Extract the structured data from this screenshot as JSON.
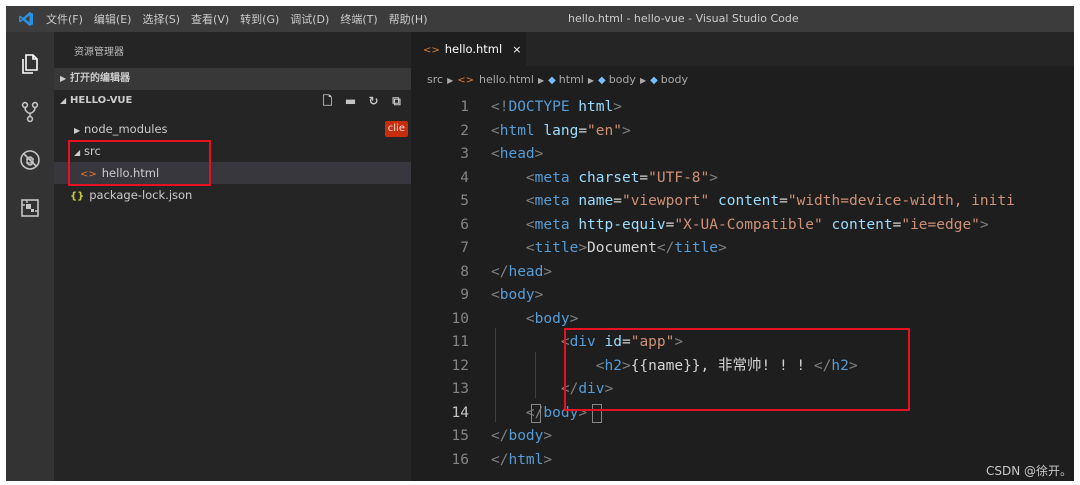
{
  "titlebar": {
    "menu": [
      "文件(F)",
      "编辑(E)",
      "选择(S)",
      "查看(V)",
      "转到(G)",
      "调试(D)",
      "终端(T)",
      "帮助(H)"
    ],
    "window_title": "hello.html - hello-vue - Visual Studio Code"
  },
  "colors": {
    "accent": "#007acc",
    "highlight_box": "#e81123",
    "badge": "#c72e0f"
  },
  "sidebar": {
    "title": "资源管理器",
    "open_editors": "打开的编辑器",
    "workspace": "HELLO-VUE",
    "workspace_actions": [
      "new-file-icon",
      "new-folder-icon",
      "refresh-icon",
      "collapse-all-icon"
    ],
    "tree": [
      {
        "label": "node_modules",
        "badge": "clie",
        "type": "folder"
      },
      {
        "label": "src",
        "type": "folder"
      },
      {
        "label": "hello.html",
        "type": "file"
      },
      {
        "label": "package-lock.json",
        "type": "file"
      }
    ]
  },
  "editor": {
    "tab": {
      "label": "hello.html",
      "close": "×"
    },
    "breadcrumb": [
      "src",
      "hello.html",
      "html",
      "body",
      "body"
    ],
    "line_numbers": [
      "1",
      "2",
      "3",
      "4",
      "5",
      "6",
      "7",
      "8",
      "9",
      "10",
      "11",
      "12",
      "13",
      "14",
      "15",
      "16"
    ],
    "code": {
      "doctype_open": "<!",
      "doctype_kw": "DOCTYPE",
      "doctype_rest": " html",
      "lang_val": "\"en\"",
      "charset_val": "\"UTF-8\"",
      "viewport_val": "\"viewport\"",
      "content_val": "\"width=device-width, initi",
      "compat_val": "\"X-UA-Compatible\"",
      "ie_val": "\"ie=edge\"",
      "title_text": "Document",
      "id_val": "\"app\"",
      "h2_text": "{{name}}, 非常帅! ! ! "
    }
  },
  "watermark": "CSDN @徐开。"
}
